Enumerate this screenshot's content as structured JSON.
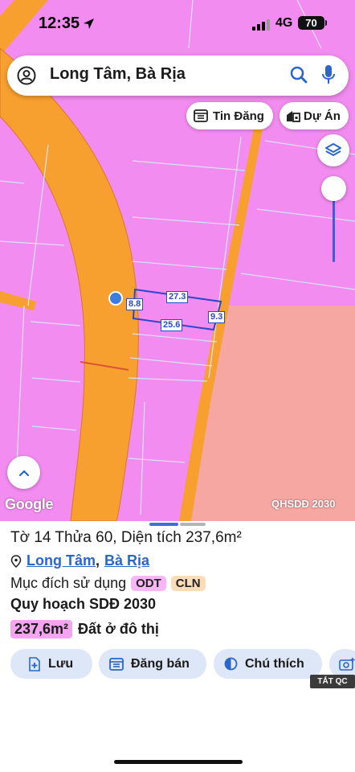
{
  "status_bar": {
    "time": "12:35",
    "network": "4G",
    "battery": "70"
  },
  "search": {
    "query": "Long Tâm, Bà Rịa"
  },
  "chips": {
    "listings": "Tin Đăng",
    "projects": "Dự Án"
  },
  "map": {
    "measurements": {
      "top": "27.3",
      "left": "8.8",
      "right": "9.3",
      "bottom": "25.6"
    },
    "attribution": "Google",
    "layer_label": "QHSDĐ 2030",
    "colors": {
      "residential": "#f28cf0",
      "road": "#f7a02f",
      "agri": "#f6a7a2",
      "boundary": "#2b4acb"
    }
  },
  "sheet": {
    "parcel_title": "Tờ 14 Thửa 60, Diện tích 237,6m²",
    "ward": "Long Tâm",
    "separator": ",",
    "city": "Bà Rịa",
    "purpose_label": "Mục đích sử dụng",
    "purpose_tags": [
      "ODT",
      "CLN"
    ],
    "plan_title": "Quy hoạch SDĐ 2030",
    "area_value": "237,6m²",
    "area_desc": "Đất ở đô thị",
    "actions": {
      "save": "Lưu",
      "post": "Đăng bán",
      "legend": "Chú thích"
    },
    "ad_label": "TẮT QC"
  }
}
